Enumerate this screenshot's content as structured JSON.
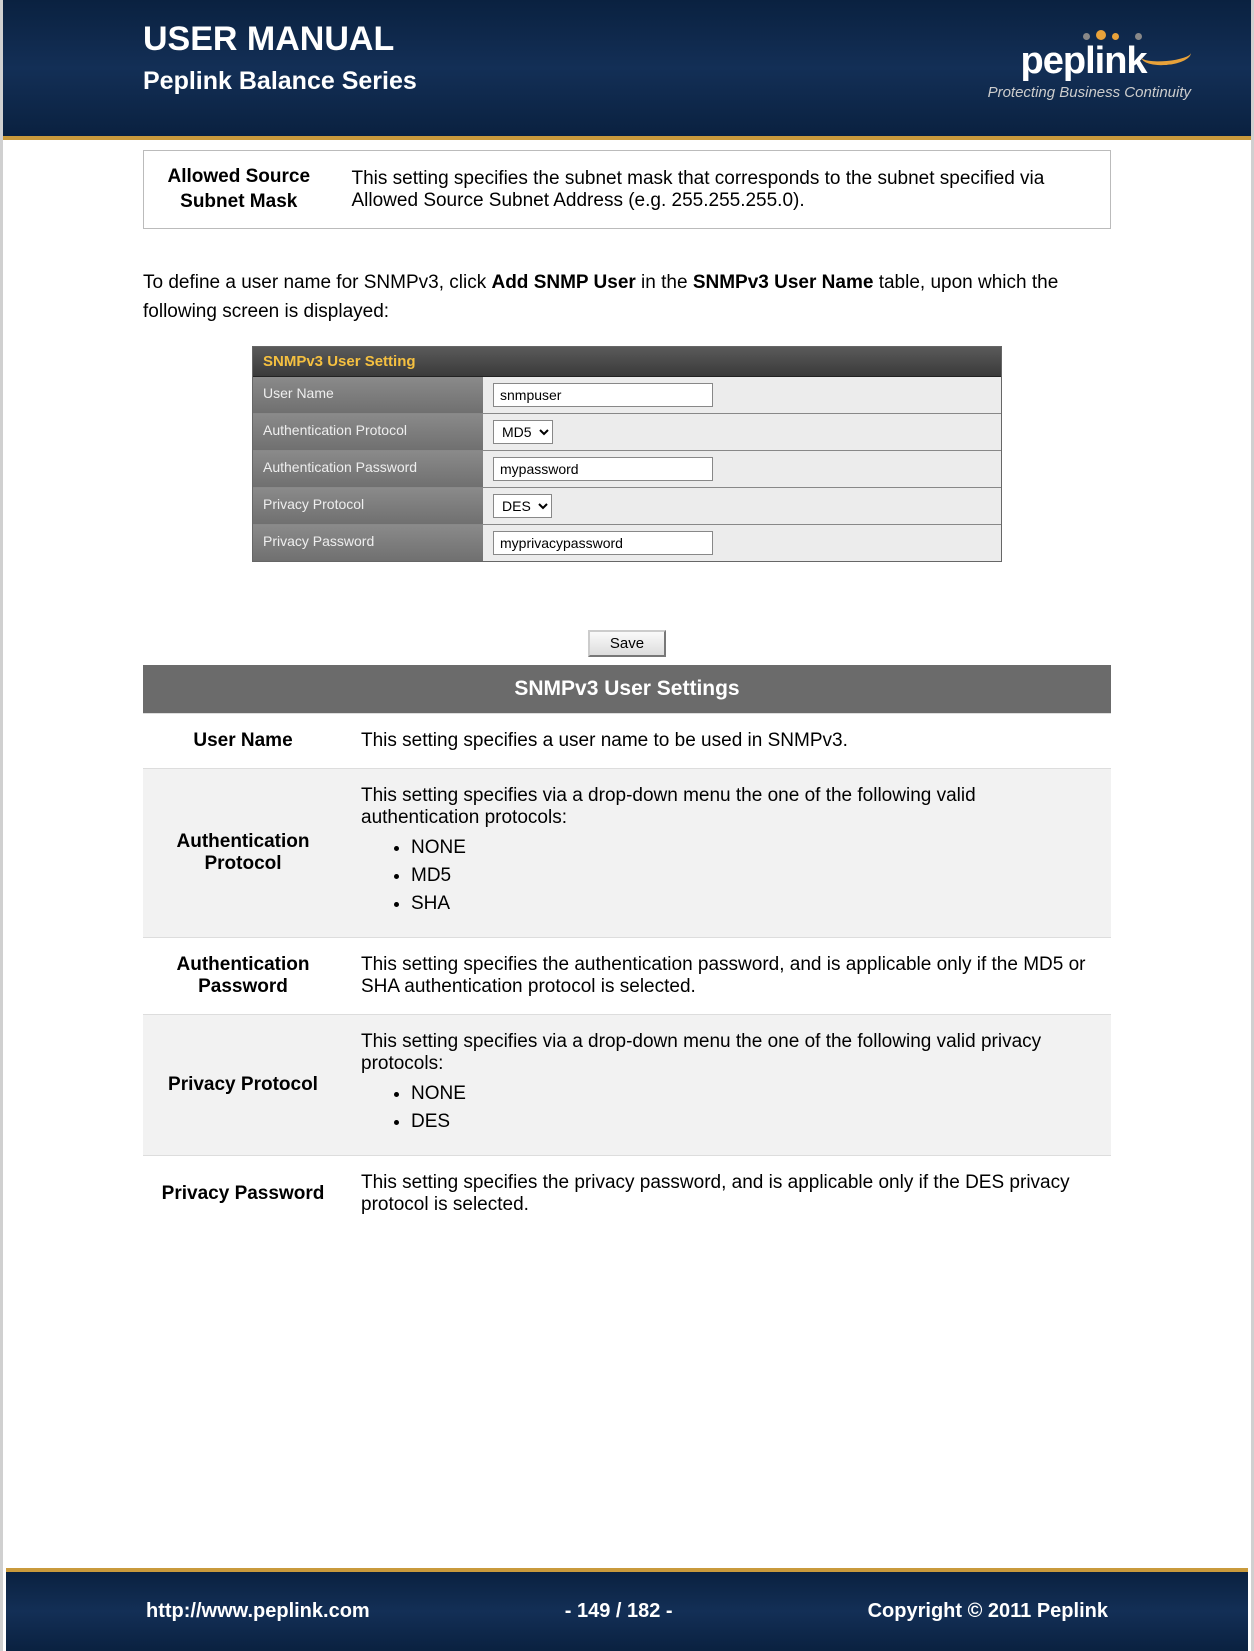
{
  "header": {
    "title": "USER MANUAL",
    "subtitle": "Peplink Balance Series",
    "logo_name": "peplink",
    "logo_tag": "Protecting Business Continuity"
  },
  "allowed_source": {
    "label": "Allowed Source Subnet Mask",
    "desc": "This setting specifies the subnet mask that corresponds to the subnet specified via Allowed Source Subnet Address (e.g. 255.255.255.0)."
  },
  "instruction": {
    "pre": "To define a user name for SNMPv3, click ",
    "b1": "Add SNMP User",
    "mid": " in the ",
    "b2": "SNMPv3 User Name",
    "post": " table, upon which the following screen is displayed:"
  },
  "screenshot": {
    "title": "SNMPv3 User Setting",
    "rows": [
      {
        "label": "User Name",
        "type": "text",
        "value": "snmpuser"
      },
      {
        "label": "Authentication Protocol",
        "type": "select",
        "value": "MD5"
      },
      {
        "label": "Authentication Password",
        "type": "text",
        "value": "mypassword"
      },
      {
        "label": "Privacy Protocol",
        "type": "select",
        "value": "DES"
      },
      {
        "label": "Privacy Password",
        "type": "text",
        "value": "myprivacypassword"
      }
    ],
    "save": "Save"
  },
  "settings_table": {
    "title": "SNMPv3 User Settings",
    "rows": [
      {
        "label": "User Name",
        "desc": "This setting specifies a user name to be used in SNMPv3.",
        "alt": false
      },
      {
        "label": "Authentication Protocol",
        "desc": "This setting specifies via a drop-down menu the one of the following valid authentication protocols:",
        "list": [
          "NONE",
          "MD5",
          "SHA"
        ],
        "alt": true
      },
      {
        "label": "Authentication Password",
        "desc": "This setting specifies the authentication password, and is applicable only if the MD5 or SHA authentication protocol is selected.",
        "alt": false
      },
      {
        "label": "Privacy Protocol",
        "desc": "This setting specifies via a drop-down menu the one of the following valid privacy protocols:",
        "list": [
          "NONE",
          "DES"
        ],
        "alt": true
      },
      {
        "label": "Privacy Password",
        "desc": "This setting specifies the privacy password, and is applicable only if the DES privacy protocol is selected.",
        "alt": false
      }
    ]
  },
  "footer": {
    "url": "http://www.peplink.com",
    "page": "- 149 / 182 -",
    "copyright": "Copyright © 2011 Peplink"
  }
}
